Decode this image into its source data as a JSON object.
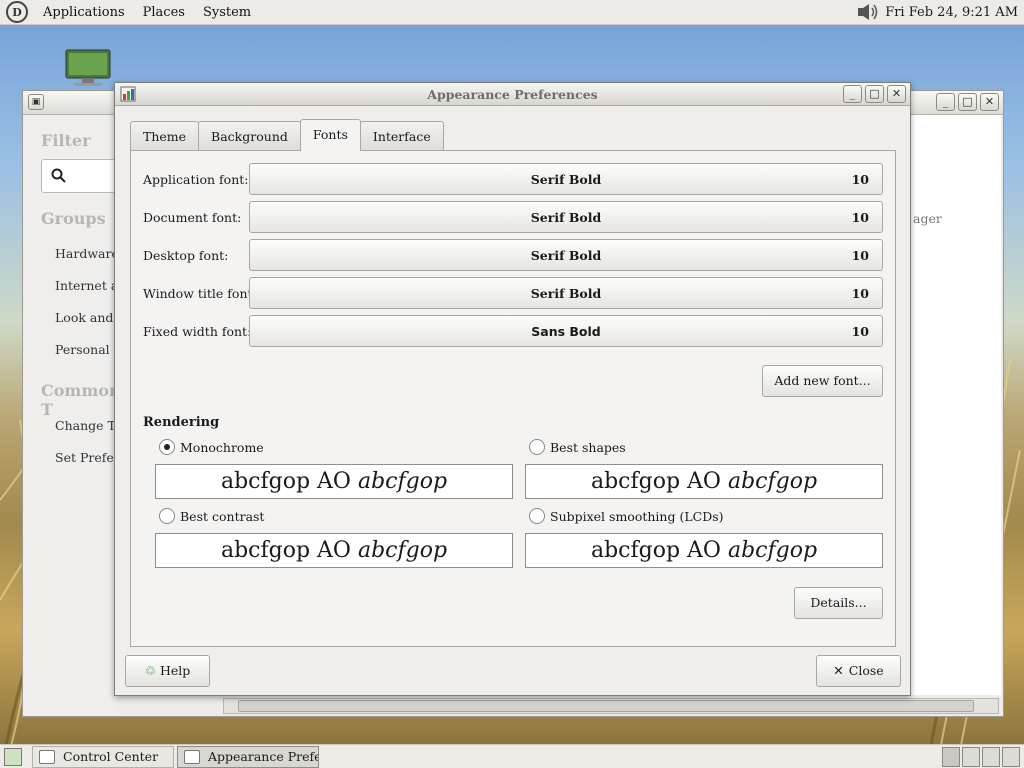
{
  "top_panel": {
    "menus": [
      "Applications",
      "Places",
      "System"
    ],
    "clock": "Fri Feb 24,  9:21 AM"
  },
  "control_center": {
    "filter_heading": "Filter",
    "groups_heading": "Groups",
    "groups": [
      "Hardware",
      "Internet and",
      "Look and F",
      "Personal"
    ],
    "common_heading": "Common T",
    "common_tasks": [
      "Change Th",
      "Set Prefere"
    ],
    "main_partial_text": "ager"
  },
  "dialog": {
    "title": "Appearance Preferences",
    "tabs": [
      "Theme",
      "Background",
      "Fonts",
      "Interface"
    ],
    "active_tab": "Fonts",
    "fonts": [
      {
        "label": "Application font:",
        "font": "Serif Bold",
        "size": "10"
      },
      {
        "label": "Document font:",
        "font": "Serif Bold",
        "size": "10"
      },
      {
        "label": "Desktop font:",
        "font": "Serif Bold",
        "size": "10"
      },
      {
        "label": "Window title font:",
        "font": "Serif Bold",
        "size": "10"
      },
      {
        "label": "Fixed width font:",
        "font": "Sans Bold",
        "size": "10"
      }
    ],
    "add_font_button": "Add new font...",
    "rendering_heading": "Rendering",
    "rendering_options": [
      {
        "label": "Monochrome",
        "selected": true
      },
      {
        "label": "Best shapes",
        "selected": false
      },
      {
        "label": "Best contrast",
        "selected": false
      },
      {
        "label": "Subpixel smoothing (LCDs)",
        "selected": false
      }
    ],
    "sample_text_regular": "abcfgop AO ",
    "sample_text_italic": "abcfgop",
    "details_button": "Details...",
    "help_button": "Help",
    "close_button": "Close"
  },
  "bottom_panel": {
    "tasks": [
      {
        "label": "Control Center",
        "active": false
      },
      {
        "label": "Appearance Prefe...",
        "active": true
      }
    ]
  }
}
